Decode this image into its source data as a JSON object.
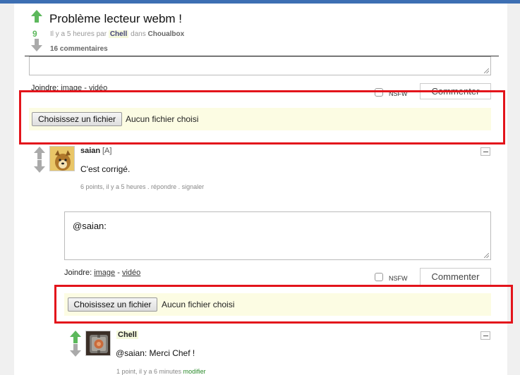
{
  "post": {
    "title": "Problème lecteur webm !",
    "score": "9",
    "meta_prefix": "Il y a 5 heures par",
    "author": "Chell",
    "meta_in": "dans",
    "category": "Choualbox",
    "comments_count": "16 commentaires"
  },
  "reply_form_top": {
    "join_label": "Joindre:",
    "image_link": "image",
    "separator": "-",
    "video_link": "vidéo",
    "nsfw_label": "NSFW",
    "submit_label": "Commenter",
    "file_button": "Choisissez un fichier",
    "file_status": "Aucun fichier choisi"
  },
  "comment_1": {
    "user": "saian",
    "tag": "[A]",
    "text": "C'est corrigé.",
    "meta": "6 points, il y a 5 heures . répondre . signaler",
    "collapse_icon": "minus-icon"
  },
  "reply_form_nested": {
    "textarea_value": "@saian:",
    "join_label": "Joindre:",
    "image_link": "image",
    "separator": "-",
    "video_link": "vidéo",
    "nsfw_label": "NSFW",
    "submit_label": "Commenter",
    "file_button": "Choisissez un fichier",
    "file_status": "Aucun fichier choisi"
  },
  "comment_2": {
    "user": "Chell",
    "text": "@saian: Merci Chef !",
    "meta_prefix": "1 point, il y a 6 minutes",
    "modify_link": "modifier",
    "collapse_icon": "minus-icon"
  },
  "colors": {
    "accent_green": "#5cb85c",
    "highlight_red": "#e3141b",
    "file_row_bg": "#fcfce3"
  }
}
